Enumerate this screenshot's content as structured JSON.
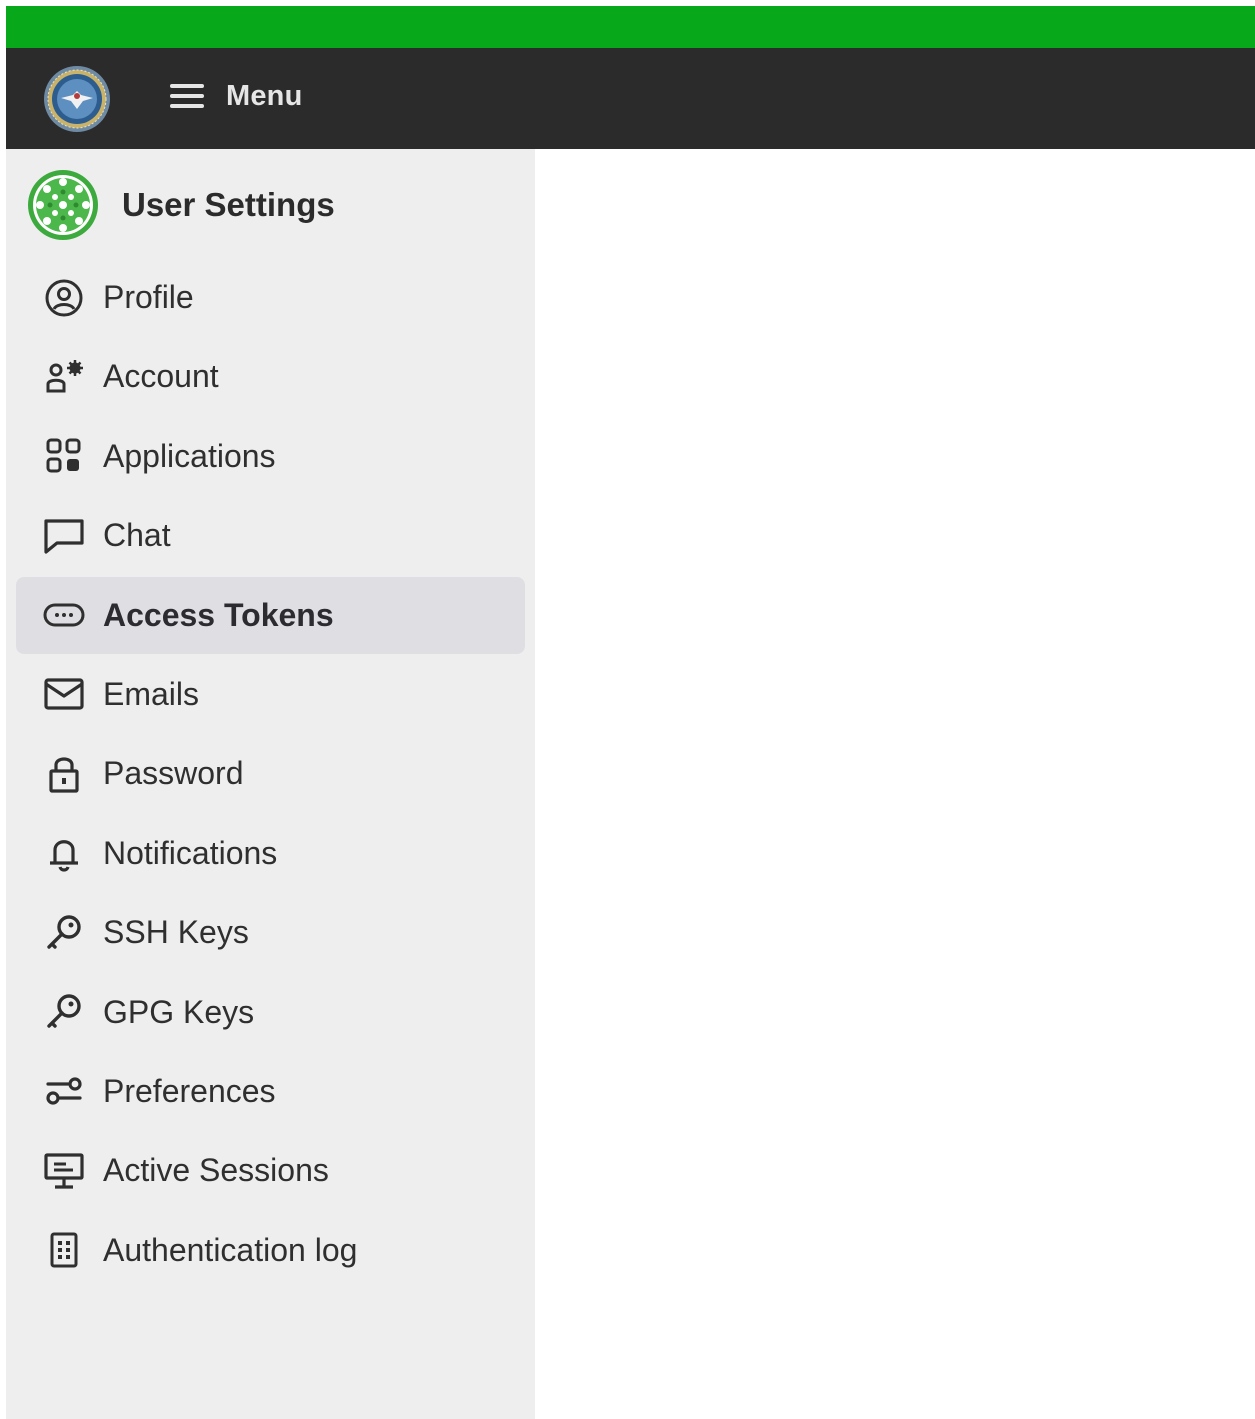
{
  "colors": {
    "banner": "#07a81a",
    "topbar": "#2b2b2b",
    "sidebar": "#eeeeee",
    "active_item": "#dfdfe3",
    "content": "#ffffff"
  },
  "topbar": {
    "logo_icon": "department-seal",
    "menu_icon": "hamburger-icon",
    "menu_label": "Menu"
  },
  "sidebar": {
    "logo_icon": "green-ring-logo",
    "title": "User Settings",
    "items": [
      {
        "label": "Profile",
        "icon": "user-circle-icon",
        "active": false
      },
      {
        "label": "Account",
        "icon": "user-gear-icon",
        "active": false
      },
      {
        "label": "Applications",
        "icon": "apps-grid-icon",
        "active": false
      },
      {
        "label": "Chat",
        "icon": "chat-bubble-icon",
        "active": false
      },
      {
        "label": "Access Tokens",
        "icon": "token-icon",
        "active": true
      },
      {
        "label": "Emails",
        "icon": "envelope-icon",
        "active": false
      },
      {
        "label": "Password",
        "icon": "lock-icon",
        "active": false
      },
      {
        "label": "Notifications",
        "icon": "bell-icon",
        "active": false
      },
      {
        "label": "SSH Keys",
        "icon": "key-icon",
        "active": false
      },
      {
        "label": "GPG Keys",
        "icon": "key-icon",
        "active": false
      },
      {
        "label": "Preferences",
        "icon": "preferences-icon",
        "active": false
      },
      {
        "label": "Active Sessions",
        "icon": "monitor-icon",
        "active": false
      },
      {
        "label": "Authentication log",
        "icon": "log-icon",
        "active": false
      }
    ]
  }
}
